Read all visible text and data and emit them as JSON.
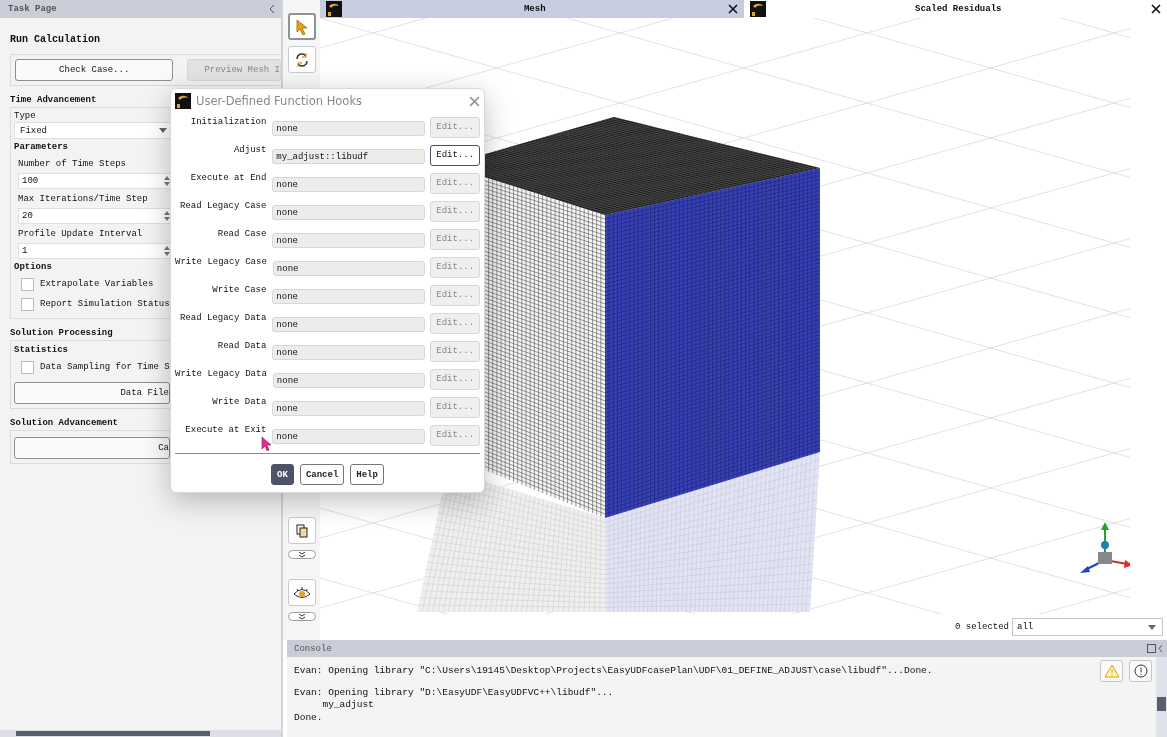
{
  "task_page": {
    "title": "Task Page",
    "heading": "Run Calculation",
    "top_buttons": [
      {
        "label": "Check Case...",
        "disabled": false
      },
      {
        "label": "Preview Mesh I",
        "disabled": true
      }
    ],
    "groups": [
      {
        "title": "Time Advancement",
        "items": [
          {
            "kind": "label",
            "text": "Type"
          },
          {
            "kind": "dropdown",
            "value": "Fixed"
          },
          {
            "kind": "subheading",
            "text": "Parameters"
          },
          {
            "kind": "number",
            "label": "Number of Time Steps",
            "value": "100"
          },
          {
            "kind": "number",
            "label": "Max Iterations/Time Step",
            "value": "20"
          },
          {
            "kind": "number",
            "label": "Profile Update Interval",
            "value": "1"
          },
          {
            "kind": "subheading",
            "text": "Options"
          },
          {
            "kind": "checkbox",
            "label": "Extrapolate Variables",
            "checked": false
          },
          {
            "kind": "checkbox",
            "label": "Report Simulation Status",
            "checked": false
          }
        ]
      },
      {
        "title": "Solution Processing",
        "items": [
          {
            "kind": "subheading",
            "text": "Statistics"
          },
          {
            "kind": "checkbox",
            "label": "Data Sampling for Time S",
            "checked": false
          },
          {
            "kind": "button",
            "label": "Data File"
          }
        ]
      },
      {
        "title": "Solution Advancement",
        "items": [
          {
            "kind": "button",
            "label": "Ca"
          }
        ]
      }
    ]
  },
  "graphics": {
    "tabs": [
      {
        "label": "Mesh",
        "selected": true
      },
      {
        "label": "Scaled Residuals",
        "selected": false
      }
    ],
    "selection_count": "0 selected",
    "selection_filter": "all"
  },
  "dialog": {
    "title": "User-Defined Function Hooks",
    "hooks": [
      {
        "label": "Initialization",
        "value": "none",
        "edit": "Edit...",
        "focused": false
      },
      {
        "label": "Adjust",
        "value": "my_adjust::libudf",
        "edit": "Edit...",
        "focused": true
      },
      {
        "label": "Execute at End",
        "value": "none",
        "edit": "Edit...",
        "focused": false
      },
      {
        "label": "Read Legacy Case",
        "value": "none",
        "edit": "Edit...",
        "focused": false
      },
      {
        "label": "Read Case",
        "value": "none",
        "edit": "Edit...",
        "focused": false
      },
      {
        "label": "Write Legacy Case",
        "value": "none",
        "edit": "Edit...",
        "focused": false
      },
      {
        "label": "Write Case",
        "value": "none",
        "edit": "Edit...",
        "focused": false
      },
      {
        "label": "Read Legacy Data",
        "value": "none",
        "edit": "Edit...",
        "focused": false
      },
      {
        "label": "Read Data",
        "value": "none",
        "edit": "Edit...",
        "focused": false
      },
      {
        "label": "Write Legacy Data",
        "value": "none",
        "edit": "Edit...",
        "focused": false
      },
      {
        "label": "Write Data",
        "value": "none",
        "edit": "Edit...",
        "focused": false
      },
      {
        "label": "Execute at Exit",
        "value": "none",
        "edit": "Edit...",
        "focused": false
      }
    ],
    "buttons": [
      {
        "label": "OK",
        "primary": true
      },
      {
        "label": "Cancel",
        "primary": false
      },
      {
        "label": "Help",
        "primary": false
      }
    ]
  },
  "console": {
    "title": "Console",
    "messages": [
      [
        "Evan: Opening library \"C:\\Users\\19145\\Desktop\\Projects\\EasyUDFcasePlan\\UDF\\01_DEFINE_ADJUST\\case\\libudf\"...Done."
      ],
      [
        "Evan: Opening library \"D:\\EasyUDF\\EasyUDFVC++\\libudf\"...",
        "     my_adjust",
        "Done."
      ]
    ]
  }
}
